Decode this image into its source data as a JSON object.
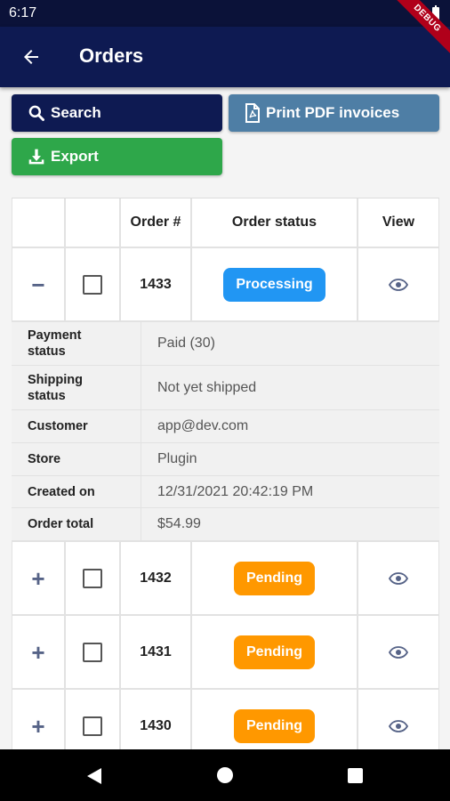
{
  "status_bar": {
    "time": "6:17",
    "debug_banner": "DEBUG"
  },
  "app_bar": {
    "title": "Orders",
    "back_icon": "arrow-left-icon"
  },
  "actions": {
    "search_label": "Search",
    "print_label": "Print PDF invoices",
    "export_label": "Export"
  },
  "colors": {
    "primary": "#0e1a52",
    "print": "#4e7ea5",
    "export": "#2ea74a",
    "processing": "#2196f3",
    "pending": "#ff9800"
  },
  "table": {
    "headers": [
      "",
      "",
      "Order #",
      "Order status",
      "View"
    ],
    "expanded_order": {
      "toggle": "−",
      "number": "1433",
      "status": "Processing",
      "details": [
        {
          "label": "Payment status",
          "value": "Paid (30)"
        },
        {
          "label": "Shipping status",
          "value": "Not yet shipped"
        },
        {
          "label": "Customer",
          "value": "app@dev.com"
        },
        {
          "label": "Store",
          "value": "Plugin"
        },
        {
          "label": "Created on",
          "value": "12/31/2021 20:42:19 PM"
        },
        {
          "label": "Order total",
          "value": "$54.99"
        }
      ]
    },
    "orders": [
      {
        "toggle": "+",
        "number": "1432",
        "status": "Pending"
      },
      {
        "toggle": "+",
        "number": "1431",
        "status": "Pending"
      },
      {
        "toggle": "+",
        "number": "1430",
        "status": "Pending"
      }
    ]
  }
}
